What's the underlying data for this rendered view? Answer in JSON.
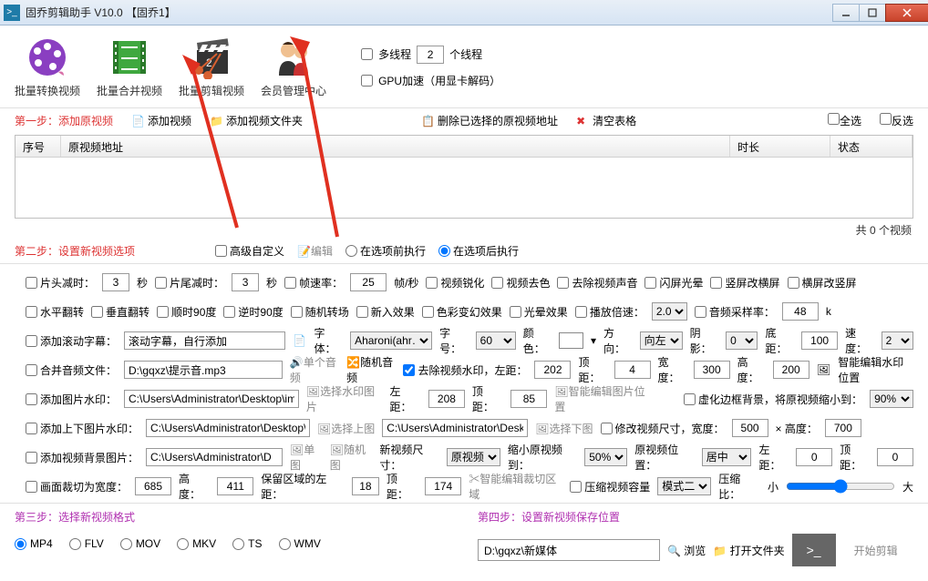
{
  "title": "固乔剪辑助手 V10.0   【固乔1】",
  "toolbar": {
    "convert": "批量转换视频",
    "merge": "批量合并视频",
    "clip": "批量剪辑视频",
    "member": "会员管理中心",
    "multithread": "多线程",
    "threads_value": "2",
    "threads_suffix": "个线程",
    "gpu": "GPU加速（用显卡解码）"
  },
  "actions": {
    "step1": "第一步：添加原视频",
    "add_video": "添加视频",
    "add_folder": "添加视频文件夹",
    "del_selected": "删除已选择的原视频地址",
    "clear": "清空表格",
    "select_all": "全选",
    "invert": "反选"
  },
  "table": {
    "seq": "序号",
    "path": "原视频地址",
    "dur": "时长",
    "stat": "状态"
  },
  "count": "共 0 个视频",
  "step2": {
    "label": "第二步：设置新视频选项",
    "advanced": "高级自定义",
    "edit": "编辑",
    "before": "在选项前执行",
    "after": "在选项后执行"
  },
  "r1": {
    "head_cut": "片头减时：",
    "head_val": "3",
    "sec1": "秒",
    "tail_cut": "片尾减时：",
    "tail_val": "3",
    "sec2": "秒",
    "fps": "帧速率：",
    "fps_val": "25",
    "fps_unit": "帧/秒",
    "sharpen": "视频锐化",
    "decolor": "视频去色",
    "rm_audio": "去除视频声音",
    "flash": "闪屏光晕",
    "v2h": "竖屏改横屏",
    "h2v": "横屏改竖屏"
  },
  "r2": {
    "hflip": "水平翻转",
    "vflip": "垂直翻转",
    "cw90": "顺时90度",
    "ccw90": "逆时90度",
    "rand_trans": "随机转场",
    "insert_fx": "新入效果",
    "color_fx": "色彩变幻效果",
    "halo_fx": "光晕效果",
    "speed": "播放倍速：",
    "speed_val": "2.0",
    "audio_rate": "音频采样率：",
    "audio_val": "48",
    "audio_unit": "k"
  },
  "r3": {
    "scroll": "添加滚动字幕：",
    "scroll_val": "滚动字幕，自行添加",
    "font": "字体：",
    "font_val": "Aharoni(ahr…",
    "size": "字号：",
    "size_val": "60",
    "color": "颜色：",
    "dir": "方向：",
    "dir_val": "向左",
    "shadow": "阴影：",
    "shadow_val": "0",
    "bottom": "底距：",
    "bottom_val": "100",
    "spd": "速度：",
    "spd_val": "2"
  },
  "r4": {
    "merge_audio": "合并音频文件：",
    "audio_path": "D:\\gqxz\\提示音.mp3",
    "single": "单个音频",
    "random": "随机音频",
    "rm_wm": "去除视频水印，左距：",
    "left_val": "202",
    "top": "顶距：",
    "top_val": "4",
    "w": "宽度：",
    "w_val": "300",
    "h": "高度：",
    "h_val": "200",
    "smart": "智能编辑水印位置"
  },
  "r5": {
    "img_wm": "添加图片水印：",
    "img_path": "C:\\Users\\Administrator\\Desktop\\img-q",
    "sel_img": "选择水印图片",
    "left": "左距：",
    "left_val": "208",
    "top": "顶距：",
    "top_val": "85",
    "smart_img": "智能编辑图片位置",
    "blur_edge": "虚化边框背景，将原视频缩小到：",
    "blur_val": "90%"
  },
  "r6": {
    "tb_wm": "添加上下图片水印：",
    "tb_path": "C:\\Users\\Administrator\\Desktop\\i",
    "sel_top": "选择上图",
    "bot_path": "C:\\Users\\Administrator\\Desk",
    "sel_bot": "选择下图",
    "resize": "修改视频尺寸，宽度：",
    "w_val": "500",
    "times": "× 高度：",
    "h_val": "700"
  },
  "r7": {
    "bg_img": "添加视频背景图片：",
    "bg_path": "C:\\Users\\Administrator\\D",
    "single": "单图",
    "random": "随机图",
    "new_size": "新视频尺寸：",
    "size_val": "原视频",
    "shrink": "缩小原视频到：",
    "shrink_val": "50%",
    "pos": "原视频位置：",
    "pos_val": "居中",
    "left": "左距：",
    "left_val": "0",
    "top": "顶距：",
    "top_val": "0"
  },
  "r8": {
    "crop": "画面裁切为宽度：",
    "w_val": "685",
    "h": "高度：",
    "h_val": "411",
    "keep_left": "保留区域的左距：",
    "kl_val": "18",
    "top": "顶距：",
    "kt_val": "174",
    "smart_crop": "智能编辑裁切区域",
    "compress": "压缩视频容量",
    "mode_val": "模式二",
    "ratio": "压缩比：",
    "small": "小",
    "big": "大"
  },
  "step3": {
    "label": "第三步：选择新视频格式",
    "mp4": "MP4",
    "flv": "FLV",
    "mov": "MOV",
    "mkv": "MKV",
    "ts": "TS",
    "wmv": "WMV"
  },
  "step4": {
    "label": "第四步：设置新视频保存位置",
    "path": "D:\\gqxz\\新媒体",
    "browse": "浏览",
    "open": "打开文件夹",
    "start": "开始剪辑"
  }
}
